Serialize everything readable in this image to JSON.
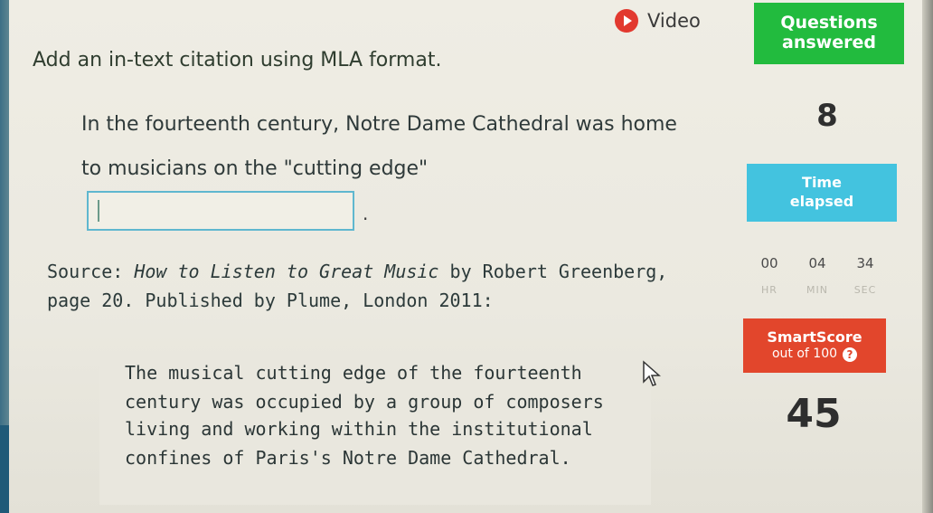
{
  "header": {
    "video_label": "Video"
  },
  "question": {
    "prompt": "Add an in-text citation using MLA format.",
    "passage_line1": "In the fourteenth century, Notre Dame Cathedral was home",
    "passage_line2": "to musicians on the \"cutting edge\"",
    "citation_value": "",
    "after_input": ".",
    "source_label": "Source: ",
    "source_title": "How to Listen to Great Music",
    "source_rest": " by Robert Greenberg,",
    "source_line2": "page 20. Published by Plume, London 2011:",
    "quote_lines": [
      "The musical cutting edge of the fourteenth",
      "century was occupied by a group of composers",
      "living and working within the institutional",
      "confines of Paris's Notre Dame Cathedral."
    ]
  },
  "sidebar": {
    "questions_answered_line1": "Questions",
    "questions_answered_line2": "answered",
    "questions_answered_value": "8",
    "time_elapsed_line1": "Time",
    "time_elapsed_line2": "elapsed",
    "timer": {
      "hr": "00",
      "min": "04",
      "sec": "34",
      "hr_label": "HR",
      "min_label": "MIN",
      "sec_label": "SEC"
    },
    "smartscore_title": "SmartScore",
    "smartscore_sub": "out of 100",
    "help_symbol": "?",
    "smartscore_value": "45"
  },
  "colors": {
    "questions_green": "#22bb3e",
    "time_blue": "#43c3df",
    "smartscore_red": "#e2462c",
    "video_red": "#e2392f"
  },
  "icons": [
    "play-icon",
    "cursor-icon",
    "help-icon"
  ]
}
